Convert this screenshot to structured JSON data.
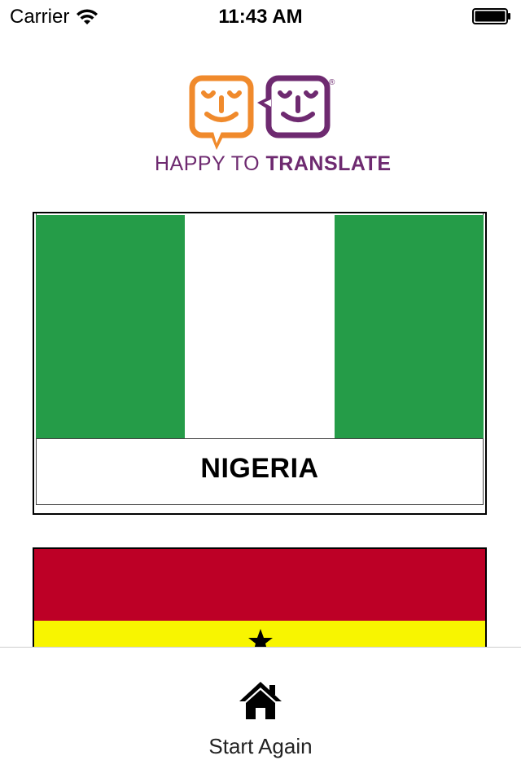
{
  "status_bar": {
    "carrier": "Carrier",
    "time": "11:43 AM"
  },
  "logo": {
    "text_light": "HAPPY TO ",
    "text_bold": "TRANSLATE",
    "trademark": "®",
    "colors": {
      "orange": "#f08a2c",
      "purple": "#6e2a70"
    }
  },
  "flags": [
    {
      "country": "NIGERIA",
      "colors": [
        "#259c48",
        "#ffffff",
        "#259c48"
      ]
    },
    {
      "country": "",
      "colors": [
        "#bd0026",
        "#f8f500"
      ]
    }
  ],
  "toolbar": {
    "start_again_label": "Start Again",
    "icon": "home-icon"
  }
}
